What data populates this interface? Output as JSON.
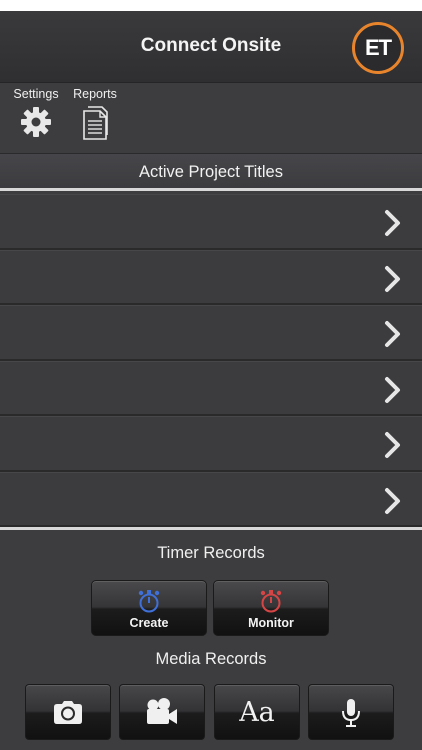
{
  "nav": {
    "title": "Connect Onsite",
    "logo_text": "ET",
    "logo_ring_color": "#e8852c"
  },
  "toolbar": {
    "settings_label": "Settings",
    "settings_icon": "gear-icon",
    "reports_label": "Reports",
    "reports_icon": "document-icon"
  },
  "projects": {
    "header": "Active Project Titles",
    "rows": [
      {
        "title": "",
        "icon": "chevron-right-icon"
      },
      {
        "title": "",
        "icon": "chevron-right-icon"
      },
      {
        "title": "",
        "icon": "chevron-right-icon"
      },
      {
        "title": "",
        "icon": "chevron-right-icon"
      },
      {
        "title": "",
        "icon": "chevron-right-icon"
      },
      {
        "title": "",
        "icon": "chevron-right-icon"
      }
    ]
  },
  "timer_records": {
    "title": "Timer Records",
    "create_label": "Create",
    "create_icon": "stopwatch-icon",
    "create_color": "#3f6fd8",
    "monitor_label": "Monitor",
    "monitor_icon": "stopwatch-icon",
    "monitor_color": "#d64545"
  },
  "media_records": {
    "title": "Media Records",
    "buttons": [
      {
        "icon": "camera-icon"
      },
      {
        "icon": "video-camera-icon"
      },
      {
        "icon": "text-icon",
        "label": "Aa"
      },
      {
        "icon": "microphone-icon"
      }
    ]
  }
}
